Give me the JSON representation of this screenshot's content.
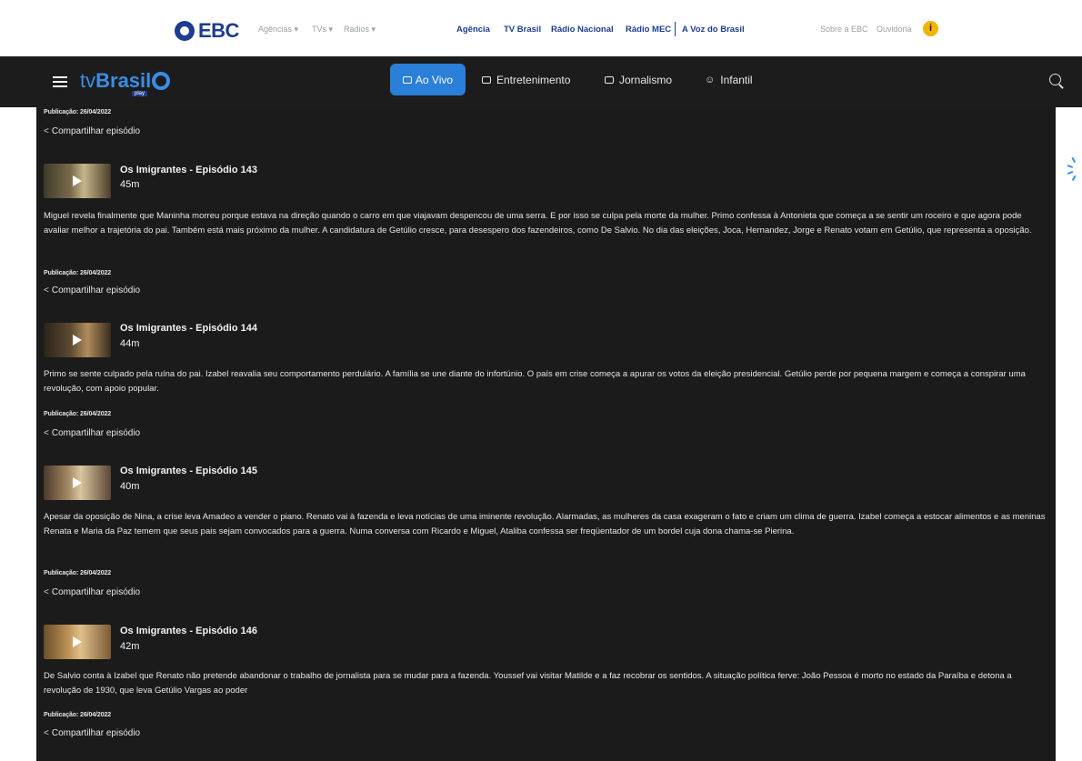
{
  "ebc": {
    "logo_text": "EBC",
    "dropdowns": [
      "Agências",
      "TVs",
      "Rádios"
    ],
    "links": [
      "Agência",
      "TV Brasil",
      "Rádio Nacional",
      "Rádio MEC",
      "A Voz do Brasil"
    ],
    "right_links": [
      "Sobre a EBC",
      "Ouvidoria"
    ],
    "accessibility_icon": "accessibility-icon"
  },
  "tvbrasil": {
    "logo_tv": "tv",
    "logo_brasil": "Brasil",
    "logo_play": "play",
    "nav": [
      {
        "label": "Ao Vivo",
        "icon": "tv-icon"
      },
      {
        "label": "Entretenimento",
        "icon": "calendar-icon"
      },
      {
        "label": "Jornalismo",
        "icon": "newspaper-icon"
      },
      {
        "label": "Infantil",
        "icon": "smile-icon"
      }
    ]
  },
  "top_publication": "Publicação: 26/04/2022",
  "share_label": "Compartilhar episódio",
  "episodes": [
    {
      "title": "Os Imigrantes - Episódio 143",
      "duration": "45m",
      "description": "Miguel revela finalmente que Maninha morreu porque estava na direção quando o carro em que viajavam despencou de uma serra. E por isso se culpa pela morte da mulher. Primo confessa à Antonieta que começa a se sentir um roceiro e que agora pode avaliar melhor a trajetória do pai. Também está mais próximo da mulher. A candidatura de Getúlio cresce, para desespero dos fazendeiros, como De Salvio. No dia das eleições, Joca, Hernandez, Jorge e Renato votam em Getúlio, que representa a oposição.",
      "publication": "Publicação: 26/04/2022",
      "share": "Compartilhar episódio"
    },
    {
      "title": "Os Imigrantes - Episódio 144",
      "duration": "44m",
      "description": "Primo se sente culpado pela ruína do pai. Izabel reavalia seu comportamento perdulário. A família se une diante do infortúnio. O país em crise começa a apurar os votos da eleição presidencial. Getúlio perde por pequena margem e começa a conspirar uma revolução, com apoio popular.",
      "publication": "Publicação: 26/04/2022",
      "share": "Compartilhar episódio"
    },
    {
      "title": "Os Imigrantes - Episódio 145",
      "duration": "40m",
      "description": "Apesar da oposição de Nina, a crise leva Amadeo a vender o piano. Renato vai à fazenda e leva notícias de uma iminente revolução. Alarmadas, as mulheres da casa exageram o fato e criam um clima de guerra. Izabel começa a estocar alimentos e as meninas Renata e Maria da Paz temem que seus pais sejam convocados para a guerra. Numa conversa com Ricardo e Miguel, Ataliba confessa ser freqüentador de um bordel cuja dona chama-se Pierina.",
      "publication": "Publicação: 26/04/2022",
      "share": "Compartilhar episódio"
    },
    {
      "title": "Os Imigrantes - Episódio 146",
      "duration": "42m",
      "description": "De Salvio conta à Izabel que Renato não pretende abandonar o trabalho de jornalista para se mudar para a fazenda. Youssef vai visitar Matilde e a faz recobrar os sentidos. A situação política ferve: João Pessoa é morto no estado da Paraíba e detona a revolução de 1930, que leva Getúlio Vargas ao poder",
      "publication": "Publicação: 26/04/2022",
      "share": "Compartilhar episódio"
    }
  ],
  "colors": {
    "ebc_blue": "#1e3c8f",
    "tvbrasil_blue": "#3a8ee6",
    "active_nav": "#2a7fd9",
    "background_dark": "#1b1b1b",
    "accessibility_yellow": "#f3b300"
  }
}
